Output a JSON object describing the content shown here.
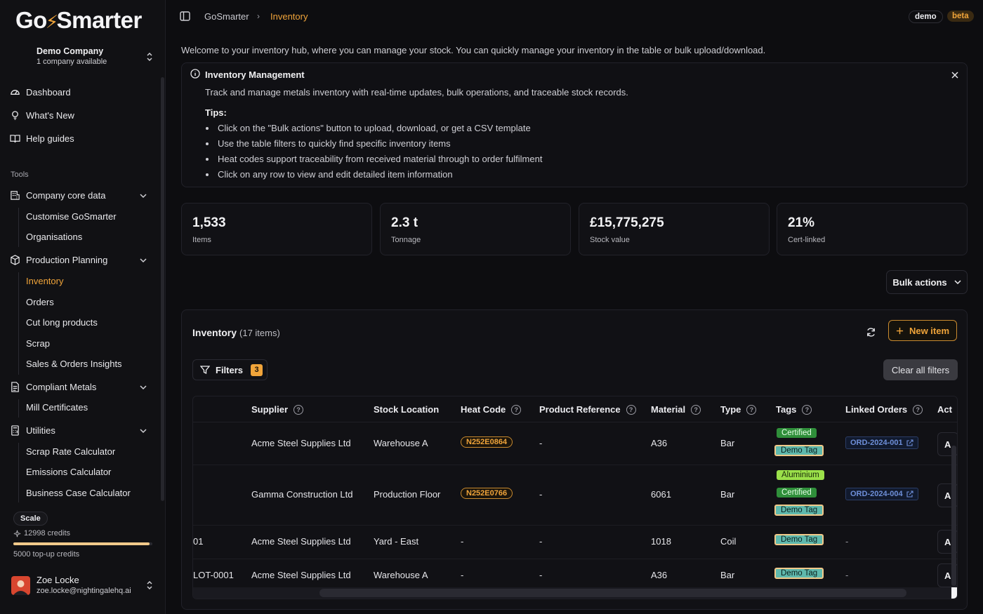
{
  "app": {
    "logo_prefix": "Go",
    "logo_suffix": "Smarter"
  },
  "company": {
    "name": "Demo Company",
    "sub": "1 company available"
  },
  "nav": {
    "dashboard": "Dashboard",
    "whats_new": "What's New",
    "help": "Help guides",
    "tools_label": "Tools",
    "company_core": "Company core data",
    "customise": "Customise GoSmarter",
    "organisations": "Organisations",
    "production_planning": "Production Planning",
    "inventory": "Inventory",
    "orders": "Orders",
    "cut_long": "Cut long products",
    "scrap": "Scrap",
    "sales_insights": "Sales & Orders Insights",
    "compliant_metals": "Compliant Metals",
    "mill_certs": "Mill Certificates",
    "utilities": "Utilities",
    "scrap_rate": "Scrap Rate Calculator",
    "emissions": "Emissions Calculator",
    "business_case": "Business Case Calculator"
  },
  "plan": {
    "name": "Scale",
    "credits": "12998 credits",
    "credits_fraction": 0.98,
    "topup": "5000 top-up credits"
  },
  "user": {
    "name": "Zoe Locke",
    "email": "zoe.locke@nightingalehq.ai"
  },
  "breadcrumb": {
    "root": "GoSmarter",
    "current": "Inventory",
    "sep": "›"
  },
  "badges": {
    "demo": "demo",
    "beta": "beta"
  },
  "welcome": "Welcome to your inventory hub, where you can manage your stock. You can quickly manage your inventory in the table or bulk upload/download.",
  "alert": {
    "title": "Inventory Management",
    "description": "Track and manage metals inventory with real-time updates, bulk operations, and traceable stock records.",
    "tips_label": "Tips:",
    "tips": [
      "Click on the \"Bulk actions\" button to upload, download, or get a CSV template",
      "Use the table filters to quickly find specific inventory items",
      "Heat codes support traceability from received material through to order fulfilment",
      "Click on any row to view and edit detailed item information"
    ]
  },
  "stats": [
    {
      "value": "1,533",
      "label": "Items"
    },
    {
      "value": "2.3 t",
      "label": "Tonnage"
    },
    {
      "value": "£15,775,275",
      "label": "Stock value"
    },
    {
      "value": "21%",
      "label": "Cert-linked"
    }
  ],
  "bulk_actions": "Bulk actions",
  "inventory": {
    "title": "Inventory",
    "count": "(17 items)",
    "new_item": "New item",
    "filters": "Filters",
    "filters_count": "3",
    "clear_filters": "Clear all filters",
    "columns": [
      "Supplier",
      "Stock Location",
      "Heat Code",
      "Product Reference",
      "Material",
      "Type",
      "Tags",
      "Linked Orders",
      "Act"
    ],
    "rows": [
      {
        "lot": "",
        "supplier": "Acme Steel Supplies Ltd",
        "location": "Warehouse A",
        "heat": "N252E0864",
        "product_ref": "-",
        "material": "A36",
        "type": "Bar",
        "tags": [
          "Certified",
          "Demo Tag"
        ],
        "linked": "ORD-2024-001",
        "action": "A"
      },
      {
        "lot": "",
        "supplier": "Gamma Construction Ltd",
        "location": "Production Floor",
        "heat": "N252E0766",
        "product_ref": "-",
        "material": "6061",
        "type": "Bar",
        "tags": [
          "Aluminium",
          "Certified",
          "Demo Tag"
        ],
        "linked": "ORD-2024-004",
        "action": "A"
      },
      {
        "lot": "01",
        "supplier": "Acme Steel Supplies Ltd",
        "location": "Yard - East",
        "heat": "-",
        "product_ref": "-",
        "material": "1018",
        "type": "Coil",
        "tags": [
          "Demo Tag"
        ],
        "linked": "-",
        "action": "A"
      },
      {
        "lot": "LOT-0001",
        "supplier": "Acme Steel Supplies Ltd",
        "location": "Warehouse A",
        "heat": "-",
        "product_ref": "-",
        "material": "A36",
        "type": "Bar",
        "tags": [
          "Demo Tag"
        ],
        "linked": "-",
        "action": "A"
      }
    ]
  }
}
